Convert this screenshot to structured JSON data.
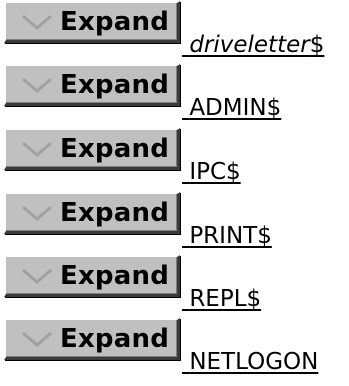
{
  "expand_label": "Expand",
  "shares": [
    {
      "prefix": " ",
      "italic": "driveletter",
      "suffix": "$"
    },
    {
      "prefix": " ",
      "italic": "",
      "suffix": "ADMIN$"
    },
    {
      "prefix": " ",
      "italic": "",
      "suffix": "IPC$"
    },
    {
      "prefix": " ",
      "italic": "",
      "suffix": "PRINT$"
    },
    {
      "prefix": " ",
      "italic": "",
      "suffix": "REPL$"
    },
    {
      "prefix": " ",
      "italic": "",
      "suffix": "NETLOGON"
    }
  ],
  "colors": {
    "button_face": "#c0c0c0",
    "chevron": "#a0a0a0",
    "text": "#000000"
  },
  "icons": {
    "chevron": "chevron-down-icon"
  }
}
